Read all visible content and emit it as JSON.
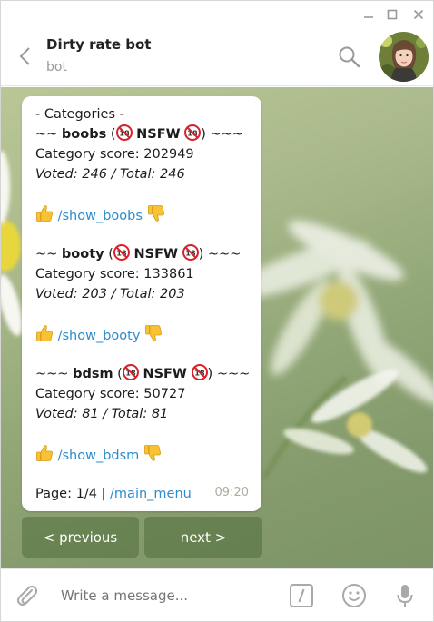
{
  "window": {
    "controls": [
      "minimize",
      "maximize",
      "close"
    ]
  },
  "header": {
    "title": "Dirty rate bot",
    "subtitle": "bot"
  },
  "message": {
    "heading": "- Categories -",
    "categories": [
      {
        "prefix": "~~ ",
        "name": "boobs",
        "tag": "NSFW",
        "suffix": ") ~~~",
        "score_line": "Category score: 202949",
        "voted_line": "Voted: 246 / Total: 246",
        "command": "/show_boobs"
      },
      {
        "prefix": "~~ ",
        "name": "booty",
        "tag": "NSFW",
        "suffix": ") ~~~",
        "score_line": "Category score: 133861",
        "voted_line": "Voted: 203 / Total: 203",
        "command": "/show_booty"
      },
      {
        "prefix": "~~~ ",
        "name": "bdsm",
        "tag": "NSFW",
        "suffix": ") ~~~",
        "score_line": "Category score: 50727",
        "voted_line": "Voted: 81 / Total: 81",
        "command": "/show_bdsm"
      }
    ],
    "page_text": "Page: 1/4 | ",
    "main_menu": "/main_menu",
    "time": "09:20"
  },
  "keyboard": {
    "prev_label": "< previous",
    "next_label": "next >"
  },
  "composer": {
    "placeholder": "Write a message..."
  },
  "colors": {
    "link": "#2c8ccc",
    "chat_bg": "#a3b585"
  }
}
